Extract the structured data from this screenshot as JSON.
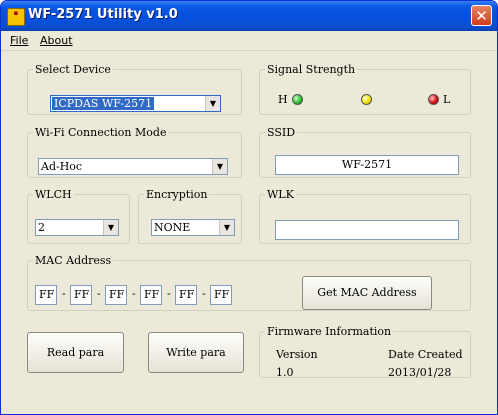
{
  "window": {
    "title": "WF-2571 Utility v1.0",
    "icon_text": "ICP DAS",
    "close_label": "✕"
  },
  "menu": {
    "file": "File",
    "about": "About"
  },
  "select_device": {
    "legend": "Select Device",
    "value": "ICPDAS WF-2571"
  },
  "signal_strength": {
    "legend": "Signal Strength",
    "high_label": "H",
    "low_label": "L",
    "colors": {
      "high": "#2fbf2f",
      "mid": "#f2e600",
      "low": "#d81010"
    }
  },
  "wifi_mode": {
    "legend": "Wi-Fi Connection Mode",
    "value": "Ad-Hoc"
  },
  "ssid": {
    "legend": "SSID",
    "value": "WF-2571"
  },
  "wlch": {
    "legend": "WLCH",
    "value": "2"
  },
  "encryption": {
    "legend": "Encryption",
    "value": "NONE"
  },
  "wlk": {
    "legend": "WLK",
    "value": ""
  },
  "mac": {
    "legend": "MAC Address",
    "octets": [
      "FF",
      "FF",
      "FF",
      "FF",
      "FF",
      "FF"
    ],
    "separator": "-",
    "get_button": "Get MAC Address"
  },
  "buttons": {
    "read": "Read para",
    "write": "Write para"
  },
  "firmware": {
    "legend": "Firmware Information",
    "version_label": "Version",
    "date_label": "Date Created",
    "version": "1.0",
    "date": "2013/01/28"
  }
}
